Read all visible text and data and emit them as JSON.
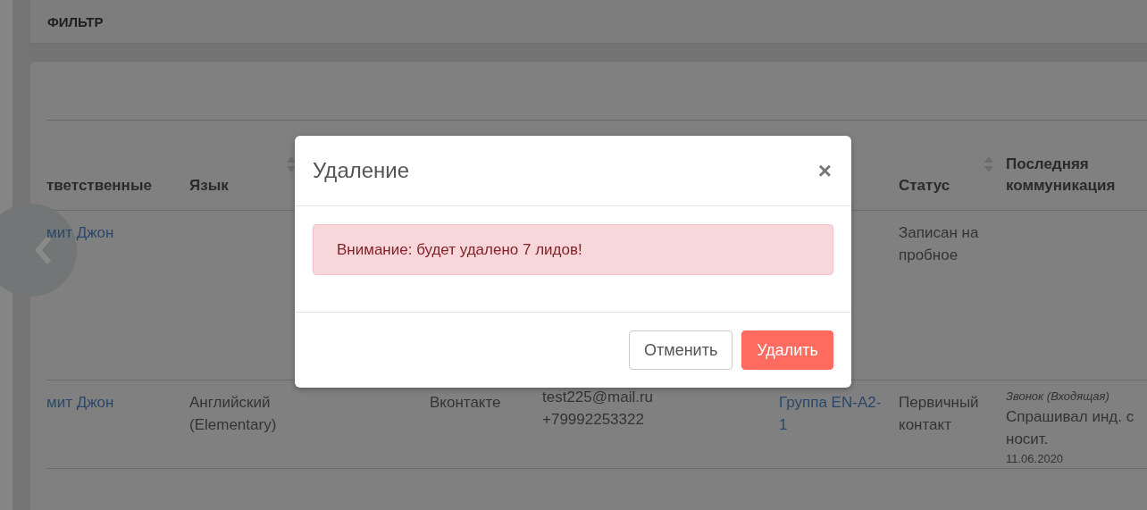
{
  "filter_bar": {
    "title": "ФИЛЬТР"
  },
  "table": {
    "columns": {
      "responsible": {
        "label": "тветственные",
        "sortable": false
      },
      "language": {
        "label": "Язык",
        "sortable": true
      },
      "status": {
        "label": "Статус",
        "sortable": true
      },
      "communication": {
        "label": "Последняя коммуникация",
        "sortable": false
      }
    },
    "rows": [
      {
        "responsible": "мит Джон",
        "status": "Записан на пробное"
      },
      {
        "responsible": "мит Джон",
        "language": "Английский (Elementary)",
        "source": "Вконтакте",
        "contacts": [
          "test225@mail.ru",
          "+79992253322"
        ],
        "group": "Группа EN-A2-1",
        "status": "Первичный контакт",
        "communication": {
          "type": "Звонок (Входящая)",
          "text": "Спрашивал инд. с носит.",
          "date": "11.06.2020"
        }
      }
    ]
  },
  "modal": {
    "title": "Удаление",
    "close": "×",
    "alert": "Внимание: будет удалено 7 лидов!",
    "buttons": [
      {
        "label": "Отменить",
        "kind": "secondary"
      },
      {
        "label": "Удалить",
        "kind": "danger"
      }
    ]
  }
}
